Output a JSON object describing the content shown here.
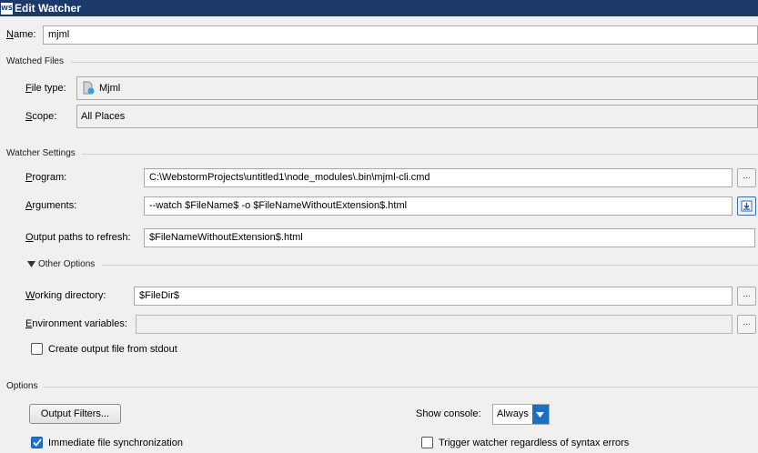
{
  "window": {
    "title": "Edit Watcher",
    "logo_text": "WS"
  },
  "name": {
    "label": "Name:",
    "value": "mjml"
  },
  "watched_files": {
    "section_title": "Watched Files",
    "file_type_label": "File type:",
    "file_type_value": "Mjml",
    "scope_label": "Scope:",
    "scope_value": "All Places"
  },
  "watcher_settings": {
    "section_title": "Watcher Settings",
    "program_label": "Program:",
    "program_value": "C:\\WebstormProjects\\untitled1\\node_modules\\.bin\\mjml-cli.cmd",
    "arguments_label": "Arguments:",
    "arguments_value": "--watch $FileName$ -o $FileNameWithoutExtension$.html",
    "output_paths_label": "Output paths to refresh:",
    "output_paths_value": "$FileNameWithoutExtension$.html",
    "other_options_label": "Other Options",
    "working_dir_label": "Working directory:",
    "working_dir_value": "$FileDir$",
    "env_vars_label": "Environment variables:",
    "env_vars_value": "",
    "browse_label": "...",
    "create_output_label": "Create output file from stdout",
    "create_output_checked": false
  },
  "options": {
    "section_title": "Options",
    "output_filters_label": "Output Filters...",
    "show_console_label": "Show console:",
    "show_console_value": "Always",
    "immediate_sync_label": "Immediate file synchronization",
    "immediate_sync_checked": true,
    "trigger_watcher_label": "Trigger watcher regardless of syntax errors",
    "trigger_watcher_checked": false
  },
  "colors": {
    "titlebar": "#1b3a6b",
    "accent": "#1a73c8"
  }
}
